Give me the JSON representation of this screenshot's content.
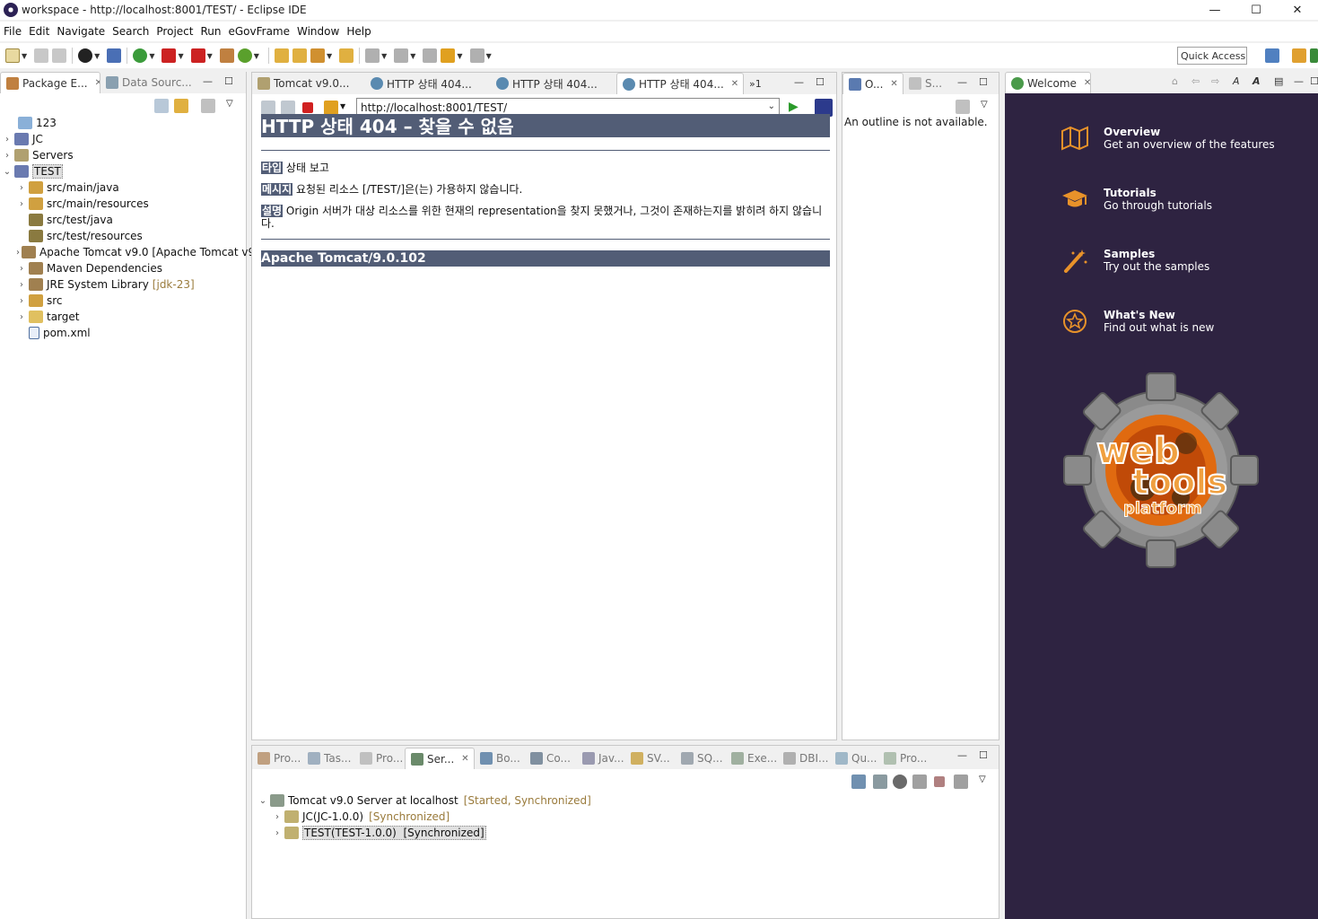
{
  "window": {
    "title": "workspace - http://localhost:8001/TEST/ - Eclipse IDE",
    "minimize": "—",
    "maximize": "☐",
    "close": "✕"
  },
  "menu": [
    "File",
    "Edit",
    "Navigate",
    "Search",
    "Project",
    "Run",
    "eGovFrame",
    "Window",
    "Help"
  ],
  "quick_access": "Quick Access",
  "left_panel": {
    "tabs": [
      "Package E...",
      "Data Sourc..."
    ],
    "tree": [
      {
        "label": "123",
        "deco": "",
        "level": 0,
        "twisty": ""
      },
      {
        "label": "JC",
        "deco": "",
        "level": 0,
        "twisty": "›"
      },
      {
        "label": "Servers",
        "deco": "",
        "level": 0,
        "twisty": "›"
      },
      {
        "label": "TEST",
        "deco": "",
        "level": 0,
        "twisty": "⌄"
      },
      {
        "label": "src/main/java",
        "deco": "",
        "level": 1,
        "twisty": "›"
      },
      {
        "label": "src/main/resources",
        "deco": "",
        "level": 1,
        "twisty": "›"
      },
      {
        "label": "src/test/java",
        "deco": "",
        "level": 1,
        "twisty": ""
      },
      {
        "label": "src/test/resources",
        "deco": "",
        "level": 1,
        "twisty": ""
      },
      {
        "label": "Apache Tomcat v9.0 [Apache Tomcat v9",
        "deco": "",
        "level": 1,
        "twisty": "›"
      },
      {
        "label": "Maven Dependencies",
        "deco": "",
        "level": 1,
        "twisty": "›"
      },
      {
        "label": "JRE System Library",
        "deco": "[jdk-23]",
        "level": 1,
        "twisty": "›"
      },
      {
        "label": "src",
        "deco": "",
        "level": 1,
        "twisty": "›"
      },
      {
        "label": "target",
        "deco": "",
        "level": 1,
        "twisty": "›"
      },
      {
        "label": "pom.xml",
        "deco": "",
        "level": 1,
        "twisty": ""
      }
    ]
  },
  "editor": {
    "tabs": [
      "Tomcat v9.0...",
      "HTTP 상태 404...",
      "HTTP 상태 404...",
      "HTTP 상태 404..."
    ],
    "overflow": "»1",
    "url": "http://localhost:8001/TEST/",
    "page": {
      "title": "HTTP 상태 404 – 찾을 수 없음",
      "type_label": "타입",
      "type_text": "상태 보고",
      "message_label": "메시지",
      "message_text": "요청된 리소스 [/TEST/]은(는) 가용하지 않습니다.",
      "desc_label": "설명",
      "desc_text": "Origin 서버가 대상 리소스를 위한 현재의 representation을 찾지 못했거나, 그것이 존재하는지를 밝히려 하지 않습니다.",
      "footer": "Apache Tomcat/9.0.102"
    }
  },
  "outline": {
    "tabs": [
      "O...",
      "S..."
    ],
    "message": "An outline is not available."
  },
  "welcome": {
    "tab": "Welcome",
    "items": [
      {
        "title": "Overview",
        "desc": "Get an overview of the features"
      },
      {
        "title": "Tutorials",
        "desc": "Go through tutorials"
      },
      {
        "title": "Samples",
        "desc": "Try out the samples"
      },
      {
        "title": "What's New",
        "desc": "Find out what is new"
      }
    ],
    "logo_lines": [
      "web",
      "tools",
      "platform"
    ]
  },
  "bottom": {
    "tabs": [
      "Pro...",
      "Tas...",
      "Pro...",
      "Ser...",
      "Bo...",
      "Co...",
      "Jav...",
      "SV...",
      "SQ...",
      "Exe...",
      "DBI...",
      "Qu...",
      "Pro..."
    ],
    "servers": {
      "server": {
        "label": "Tomcat v9.0 Server at localhost",
        "status": "[Started, Synchronized]"
      },
      "modules": [
        {
          "label": "JC(JC-1.0.0)",
          "status": "[Synchronized]"
        },
        {
          "label": "TEST(TEST-1.0.0)",
          "status": "[Synchronized]"
        }
      ]
    }
  },
  "colors": {
    "tomcat_header": "#525d76",
    "welcome_bg": "#2e2341",
    "decoration": "#9a7b3c"
  }
}
